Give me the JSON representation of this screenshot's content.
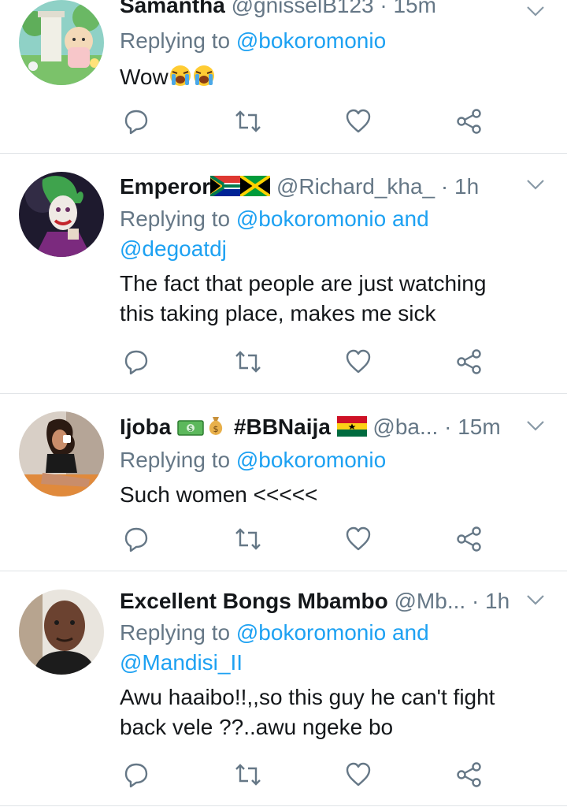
{
  "tweets": [
    {
      "name": "Samantha",
      "handle": "@gnisselB123",
      "time": "· 15m",
      "replying_label": "Replying to",
      "mentions_line1": "@bokoromonio",
      "mentions_line2": "",
      "text": [
        "Wow"
      ],
      "emojis": [
        "loudly-crying-face",
        "loudly-crying-face"
      ]
    },
    {
      "name": "Emperor",
      "name_flags": [
        "south-africa-flag",
        "jamaica-flag"
      ],
      "handle": "@Richard_kha_",
      "time": "· 1h",
      "replying_label": "Replying to",
      "mentions_line1": "@bokoromonio and",
      "mentions_line2": "@degoatdj",
      "text": [
        "The fact that people are just watching",
        "this taking place, makes me sick"
      ]
    },
    {
      "name": "Ijoba",
      "name_emojis": [
        "dollar-banknote",
        "money-bag"
      ],
      "name_tag": "#BBNaija",
      "name_flags": [
        "ghana-flag"
      ],
      "handle": "@ba...",
      "time": "· 15m",
      "replying_label": "Replying to",
      "mentions_line1": "@bokoromonio",
      "mentions_line2": "",
      "text": [
        "Such women <<<<<"
      ]
    },
    {
      "name": "Excellent Bongs Mbambo",
      "handle": "@Mb...",
      "time": "· 1h",
      "replying_label": "Replying to",
      "mentions_line1": "@bokoromonio and",
      "mentions_line2": "@Mandisi_II",
      "text": [
        "Awu haaibo!!,,so this guy he can't fight",
        "back vele ??..awu ngeke bo"
      ]
    }
  ],
  "icons": {
    "reply": "reply-icon",
    "retweet": "retweet-icon",
    "like": "like-icon",
    "share": "share-icon",
    "more": "chevron-down-icon"
  },
  "colors": {
    "name": "#14171a",
    "meta": "#657786",
    "mention": "#1da1f2",
    "divider": "#dfe3e6"
  }
}
